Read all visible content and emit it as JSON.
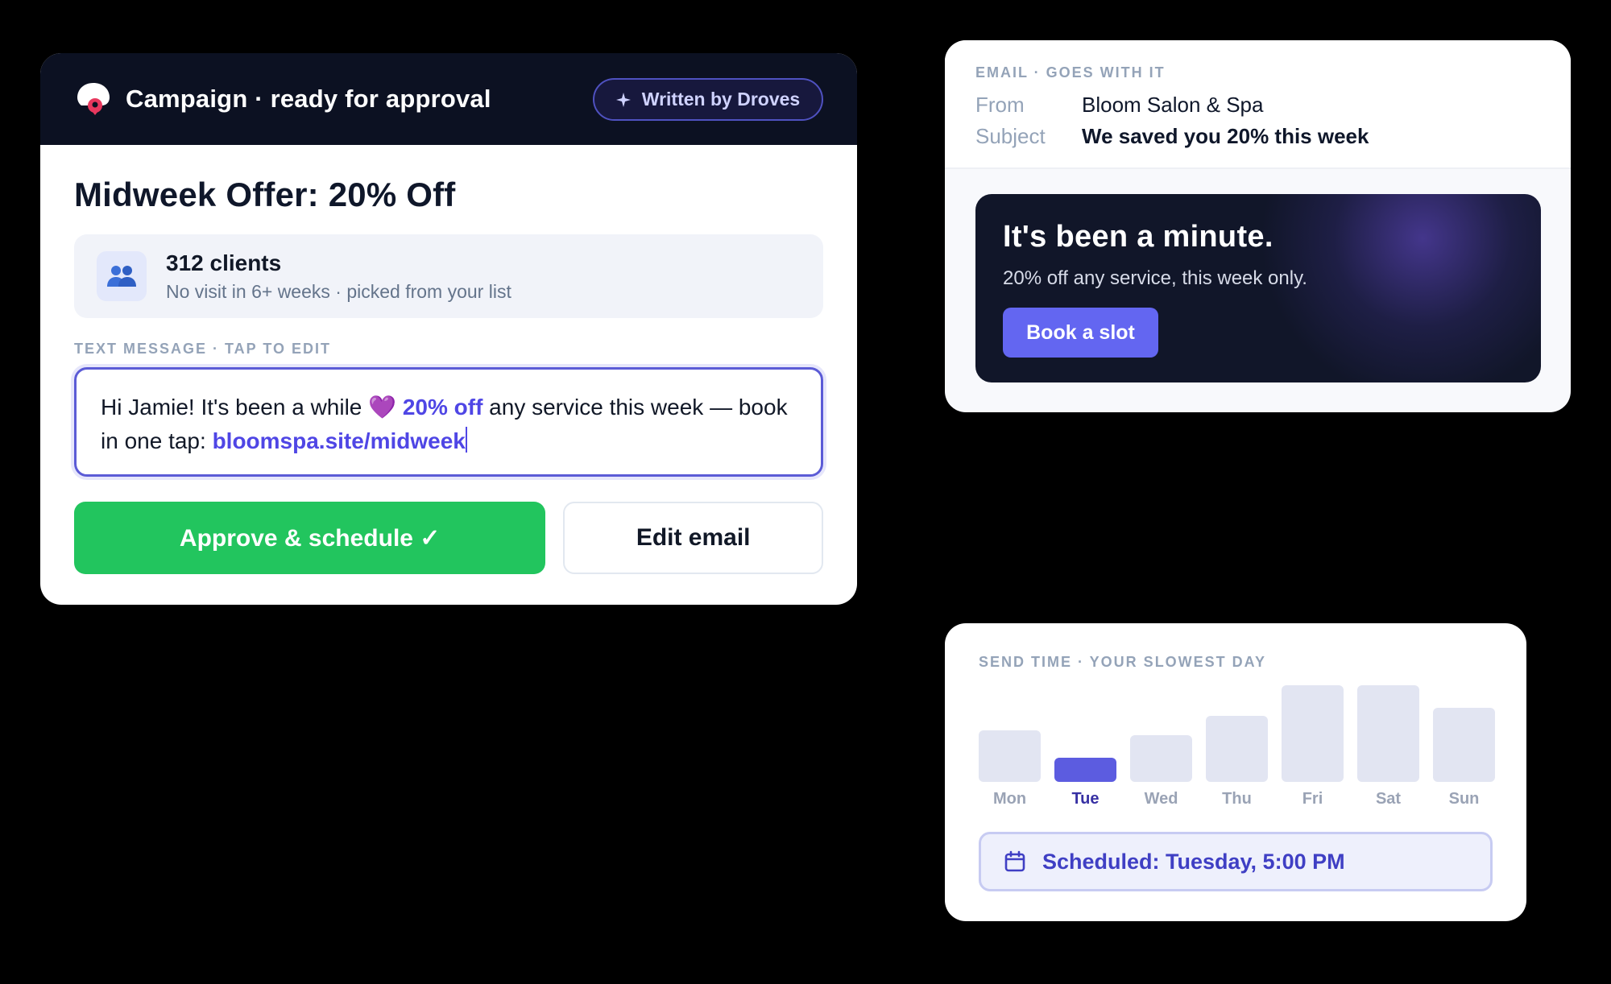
{
  "campaign": {
    "header_title": "Campaign · ready for approval",
    "badge_label": "Written by Droves",
    "offer_title": "Midweek Offer: 20% Off",
    "audience": {
      "count": "312 clients",
      "description": "No visit in 6+ weeks · picked from your list"
    },
    "sms_label": "TEXT MESSAGE · TAP TO EDIT",
    "sms": {
      "part1": "Hi Jamie! It's been a while ",
      "emoji": "💜",
      "highlight": "20% off",
      "part2": " any service this week — book in one tap: ",
      "link": "bloomspa.site/midweek"
    },
    "approve_label": "Approve & schedule ✓",
    "edit_label": "Edit email"
  },
  "email": {
    "label": "EMAIL · GOES WITH IT",
    "from_key": "From",
    "from_value": "Bloom Salon & Spa",
    "subject_key": "Subject",
    "subject_value": "We saved you 20% this week",
    "hero_title": "It's been a minute.",
    "hero_sub": "20% off any service, this week only.",
    "book_label": "Book a slot"
  },
  "send_time": {
    "label": "SEND TIME · YOUR SLOWEST DAY",
    "scheduled": "Scheduled: Tuesday, 5:00 PM"
  },
  "chart_data": {
    "type": "bar",
    "categories": [
      "Mon",
      "Tue",
      "Wed",
      "Thu",
      "Fri",
      "Sat",
      "Sun"
    ],
    "values": [
      0.53,
      0.25,
      0.48,
      0.68,
      1.0,
      1.0,
      0.77
    ],
    "highlight": "Tue",
    "highlight_color": "#5c5ce0",
    "bar_color": "#e2e5f2"
  },
  "colors": {
    "accent": "#4f46e5",
    "approve": "#22c55e",
    "header_bg": "#0c1122"
  }
}
